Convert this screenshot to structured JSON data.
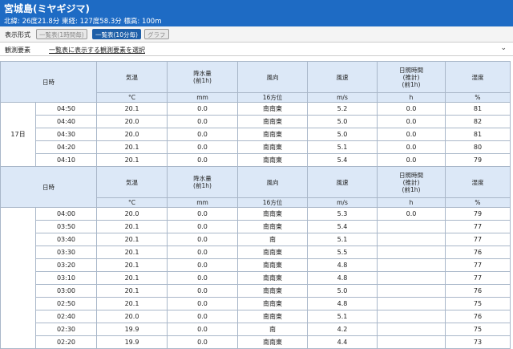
{
  "header": {
    "title": "宮城島(ミヤギジマ)",
    "coords": "北緯: 26度21.8分 東経: 127度58.3分 標高: 100m"
  },
  "display_mode": {
    "label": "表示形式",
    "buttons": [
      "一覧表(1時間毎)",
      "一覧表(10分毎)",
      "グラフ"
    ],
    "active": "一覧表(10分毎)"
  },
  "elements": {
    "label": "観測要素",
    "link": "一覧表に表示する観測要素を選択",
    "chevron": "chevron-down-icon"
  },
  "table": {
    "headers": [
      "日時",
      "気温",
      "降水量\n(前1h)",
      "風向",
      "風速",
      "日照時間\n(推計)\n(前1h)",
      "湿度"
    ],
    "units": [
      "°C",
      "mm",
      "16方位",
      "m/s",
      "h",
      "%"
    ],
    "date": "17日",
    "group1": [
      [
        "04:50",
        "20.1",
        "0.0",
        "南南東",
        "5.2",
        "0.0",
        "81"
      ],
      [
        "04:40",
        "20.0",
        "0.0",
        "南南東",
        "5.0",
        "0.0",
        "82"
      ],
      [
        "04:30",
        "20.0",
        "0.0",
        "南南東",
        "5.0",
        "0.0",
        "81"
      ],
      [
        "04:20",
        "20.1",
        "0.0",
        "南南東",
        "5.1",
        "0.0",
        "80"
      ],
      [
        "04:10",
        "20.1",
        "0.0",
        "南南東",
        "5.4",
        "0.0",
        "79"
      ]
    ],
    "group2": [
      [
        "04:00",
        "20.0",
        "0.0",
        "南南東",
        "5.3",
        "0.0",
        "79"
      ],
      [
        "03:50",
        "20.1",
        "0.0",
        "南南東",
        "5.4",
        "",
        "77"
      ],
      [
        "03:40",
        "20.1",
        "0.0",
        "南",
        "5.1",
        "",
        "77"
      ],
      [
        "03:30",
        "20.1",
        "0.0",
        "南南東",
        "5.5",
        "",
        "76"
      ],
      [
        "03:20",
        "20.1",
        "0.0",
        "南南東",
        "4.8",
        "",
        "77"
      ],
      [
        "03:10",
        "20.1",
        "0.0",
        "南南東",
        "4.8",
        "",
        "77"
      ],
      [
        "03:00",
        "20.1",
        "0.0",
        "南南東",
        "5.0",
        "",
        "76"
      ],
      [
        "02:50",
        "20.1",
        "0.0",
        "南南東",
        "4.8",
        "",
        "75"
      ],
      [
        "02:40",
        "20.0",
        "0.0",
        "南南東",
        "5.1",
        "",
        "76"
      ],
      [
        "02:30",
        "19.9",
        "0.0",
        "南",
        "4.2",
        "",
        "75"
      ],
      [
        "02:20",
        "19.9",
        "0.0",
        "南南東",
        "4.4",
        "",
        "73"
      ]
    ]
  }
}
